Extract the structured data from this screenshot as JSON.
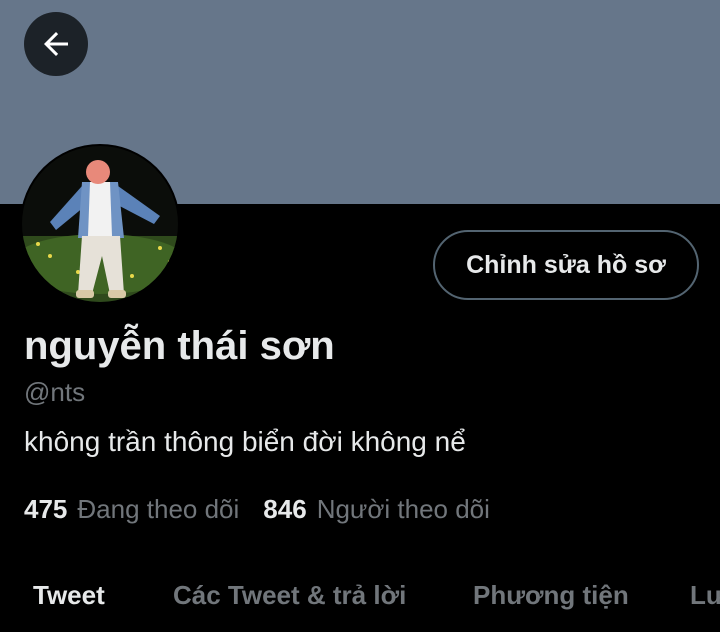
{
  "header": {
    "back_icon": "arrow-left-icon",
    "banner_color": "#66768a"
  },
  "profile": {
    "avatar_icon": "profile-photo",
    "edit_button_label": "Chỉnh sửa hồ sơ",
    "display_name": "nguyễn thái sơn",
    "handle": "@nts",
    "bio": "không trần thông biển đời không nể",
    "following_count": "475",
    "following_label": "Đang theo dõi",
    "followers_count": "846",
    "followers_label": "Người theo dõi"
  },
  "tabs": [
    {
      "label": "Tweet",
      "active": true
    },
    {
      "label": "Các Tweet & trả lời",
      "active": false
    },
    {
      "label": "Phương tiện",
      "active": false
    },
    {
      "label": "Lượt thích",
      "active": false
    }
  ],
  "colors": {
    "background": "#000000",
    "primary_text": "#e7e9ea",
    "secondary_text": "#71767b",
    "border": "#536471"
  }
}
